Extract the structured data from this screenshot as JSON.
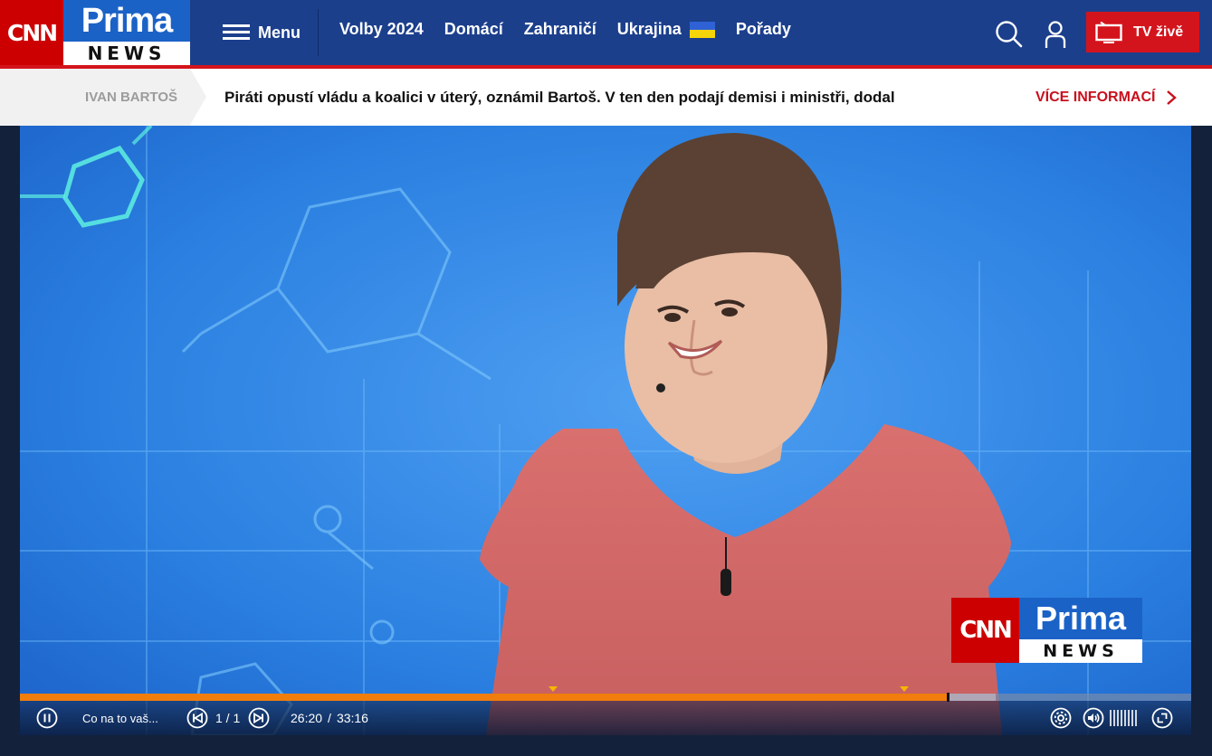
{
  "header": {
    "logo": {
      "cnn": "CNN",
      "prima": "Prima",
      "news": "NEWS"
    },
    "menu_label": "Menu",
    "nav": [
      {
        "label": "Volby 2024"
      },
      {
        "label": "Domácí"
      },
      {
        "label": "Zahraničí"
      },
      {
        "label": "Ukrajina",
        "icon": "ukraine-flag-icon"
      },
      {
        "label": "Pořady"
      }
    ],
    "tv_label": "TV živě",
    "colors": {
      "header_bg": "#1c3f8c",
      "accent_red": "#d4141c",
      "brand_blue": "#1b62c6"
    }
  },
  "ticker": {
    "tag": "IVAN BARTOŠ",
    "headline": "Piráti opustí vládu a koalici v úterý, oznámil Bartoš. V ten den podají demisi i ministři, dodal",
    "more_label": "VÍCE INFORMACÍ"
  },
  "player": {
    "overlay_logo": {
      "cnn": "CNN",
      "prima": "Prima",
      "news": "NEWS"
    },
    "title": "Co na to vaš...",
    "playlist_position": "1 / 1",
    "current_time": "26:20",
    "time_separator": "/",
    "duration": "33:16",
    "progress_fraction": 0.792,
    "buffered_fraction": 0.833,
    "chapter_markers": [
      "chapter-marker-1",
      "chapter-marker-2"
    ],
    "colors": {
      "progress": "#f07d0c",
      "marker": "#f5b700"
    }
  }
}
